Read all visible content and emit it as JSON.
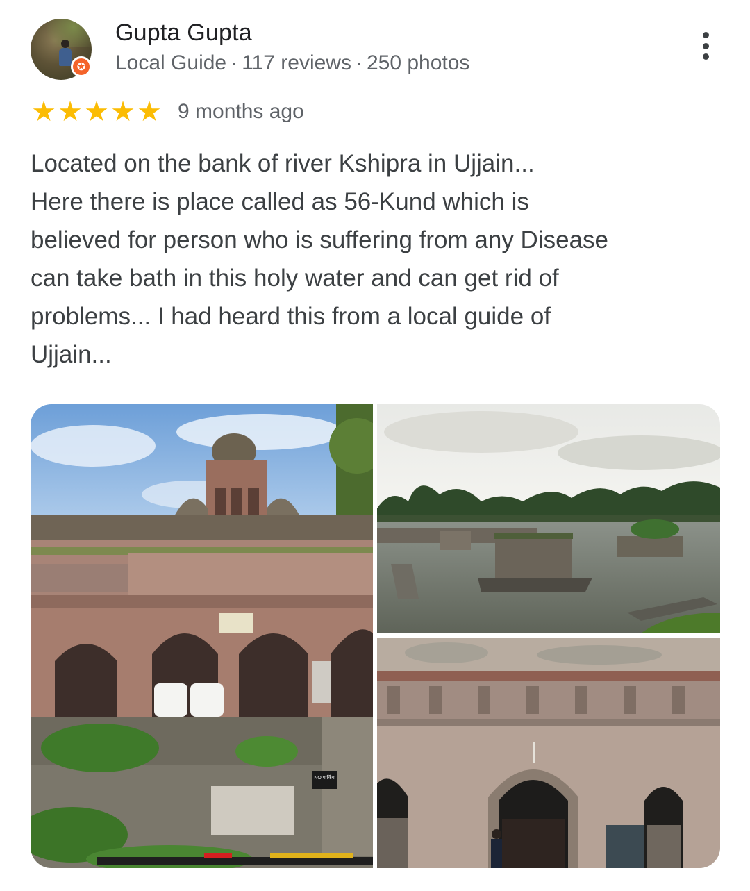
{
  "reviewer": {
    "name": "Gupta Gupta",
    "badge": "Local Guide",
    "reviews": "117 reviews",
    "photos": "250 photos",
    "separator": "·",
    "avatar_icon": "user-avatar",
    "badge_icon": "local-guide-star-icon",
    "badge_color": "#f4632a"
  },
  "rating": {
    "stars": 5,
    "max": 5,
    "star_glyph": "★",
    "star_color": "#fbbc04",
    "time": "9 months ago"
  },
  "menu": {
    "icon": "more-vert-icon"
  },
  "review": {
    "lines": [
      "Located on the bank of river Kshipra in Ujjain...",
      "Here there is place called as 56-Kund which is",
      "believed for person who is suffering from any Disease",
      "can take bath in this holy water and can get rid of",
      "problems... I had heard this from a local guide of",
      "Ujjain..."
    ]
  },
  "photos": [
    {
      "subject": "stone temple facade with domed tower and arches",
      "sign_text": "NO पार्किंग"
    },
    {
      "subject": "river Kshipra with submerged stone kund structures"
    },
    {
      "subject": "close-up of arched stone facade with person at door"
    }
  ]
}
